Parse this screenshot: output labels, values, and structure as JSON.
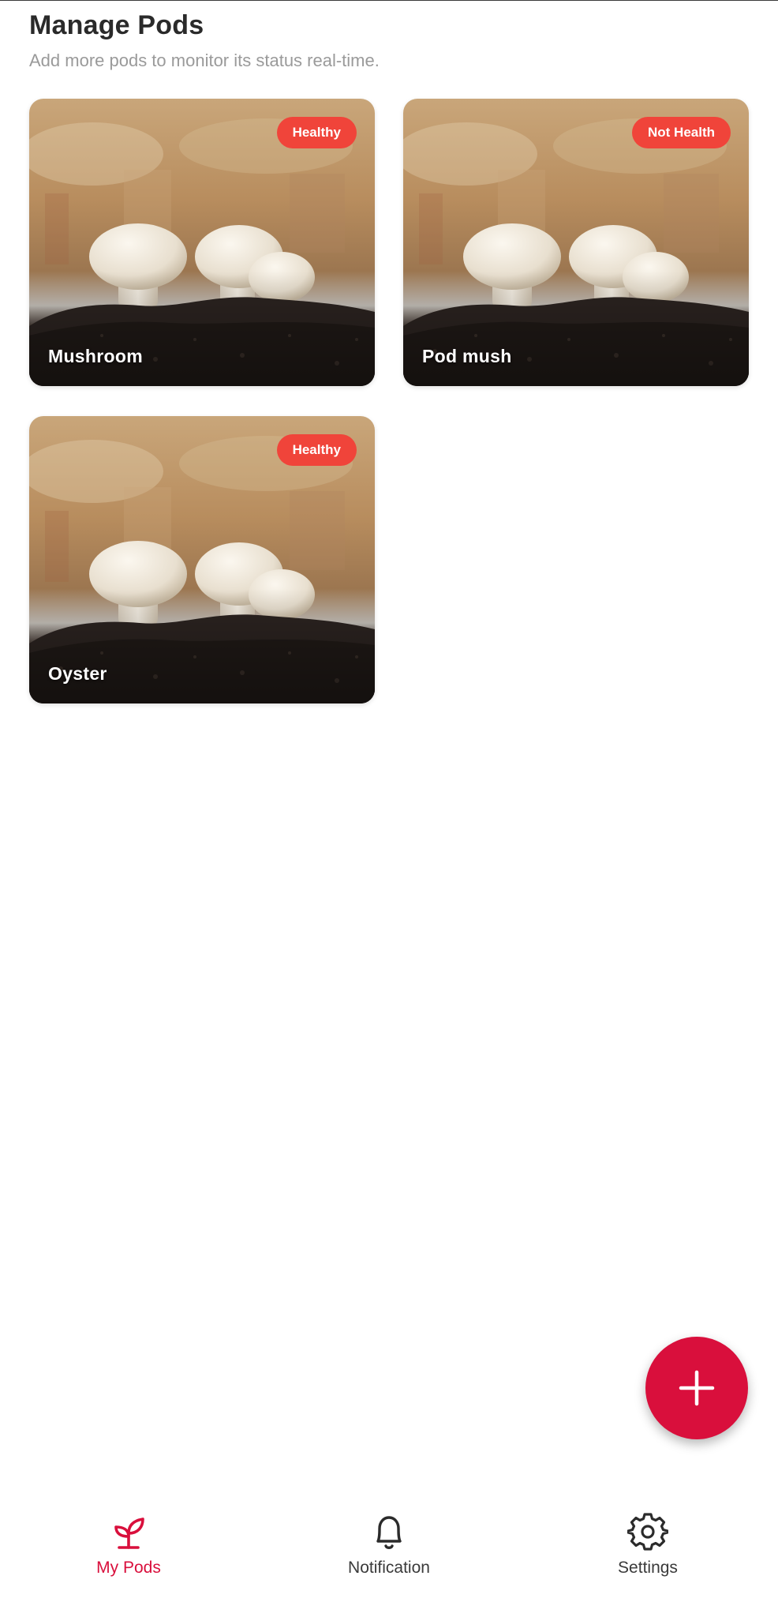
{
  "header": {
    "title": "Manage Pods",
    "subtitle": "Add more pods to monitor its status real-time."
  },
  "pods": [
    {
      "name": "Mushroom",
      "status": "Healthy"
    },
    {
      "name": "Pod mush",
      "status": "Not Health"
    },
    {
      "name": "Oyster",
      "status": "Healthy"
    }
  ],
  "fab": {
    "icon": "plus-icon"
  },
  "nav": {
    "items": [
      {
        "label": "My Pods",
        "icon": "sprout-icon",
        "active": true
      },
      {
        "label": "Notification",
        "icon": "bell-icon",
        "active": false
      },
      {
        "label": "Settings",
        "icon": "gear-icon",
        "active": false
      }
    ]
  },
  "colors": {
    "accent": "#d90f3c",
    "badge": "#f0443a",
    "subtitle": "#9a9a9a"
  }
}
